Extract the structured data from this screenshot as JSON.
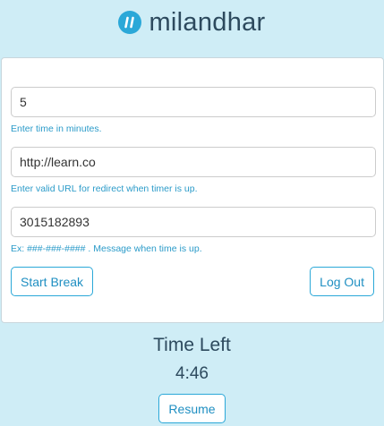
{
  "header": {
    "brand": "milandhar",
    "logo_icon": "pause-icon"
  },
  "form": {
    "minutes": {
      "value": "5",
      "help": "Enter time in minutes."
    },
    "url": {
      "value": "http://learn.co",
      "help": "Enter valid URL for redirect when timer is up."
    },
    "phone": {
      "value": "3015182893",
      "help": "Ex: ###-###-#### . Message when time is up."
    },
    "start_break_label": "Start Break",
    "logout_label": "Log Out"
  },
  "timer": {
    "title": "Time Left",
    "value": "4:46",
    "resume_label": "Resume"
  },
  "colors": {
    "background": "#cfedf6",
    "accent": "#2ba8d8",
    "text": "#2d4a5e"
  }
}
